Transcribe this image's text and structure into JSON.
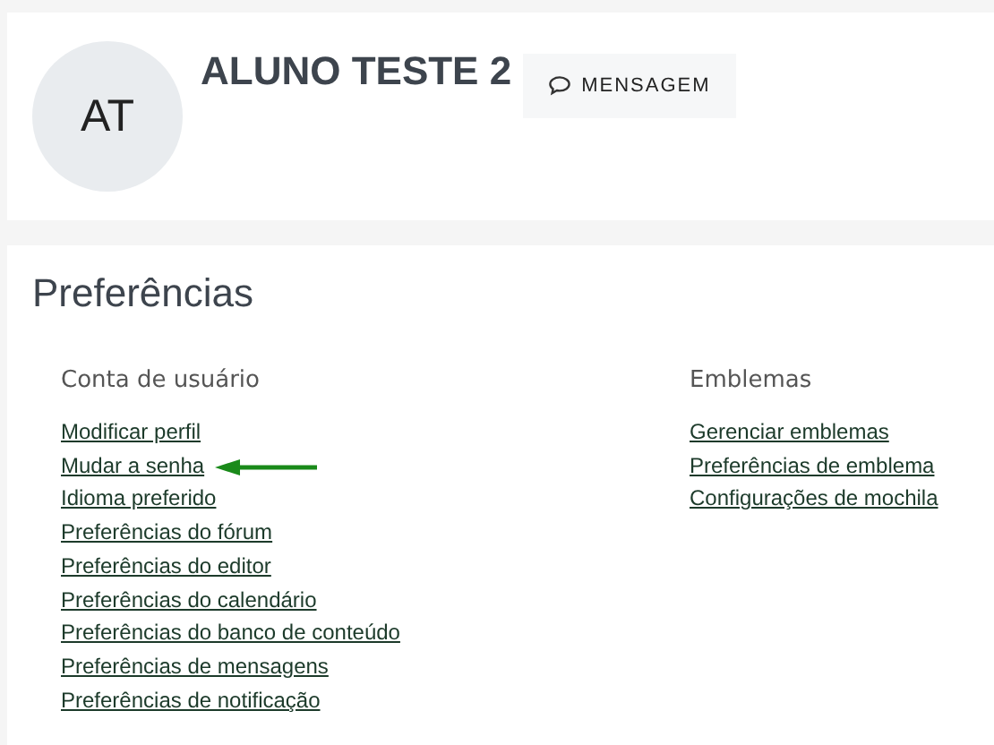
{
  "profile": {
    "initials": "AT",
    "name": "ALUNO TESTE 2",
    "message_button": "MENSAGEM"
  },
  "preferences": {
    "title": "Preferências",
    "sections": [
      {
        "heading": "Conta de usuário",
        "links": [
          "Modificar perfil",
          "Mudar a senha",
          "Idioma preferido",
          "Preferências do fórum",
          "Preferências do editor",
          "Preferências do calendário",
          "Preferências do banco de conteúdo",
          "Preferências de mensagens",
          "Preferências de notificação"
        ]
      },
      {
        "heading": "Emblemas",
        "links": [
          "Gerenciar emblemas",
          "Preferências de emblema",
          "Configurações de mochila"
        ]
      }
    ]
  }
}
